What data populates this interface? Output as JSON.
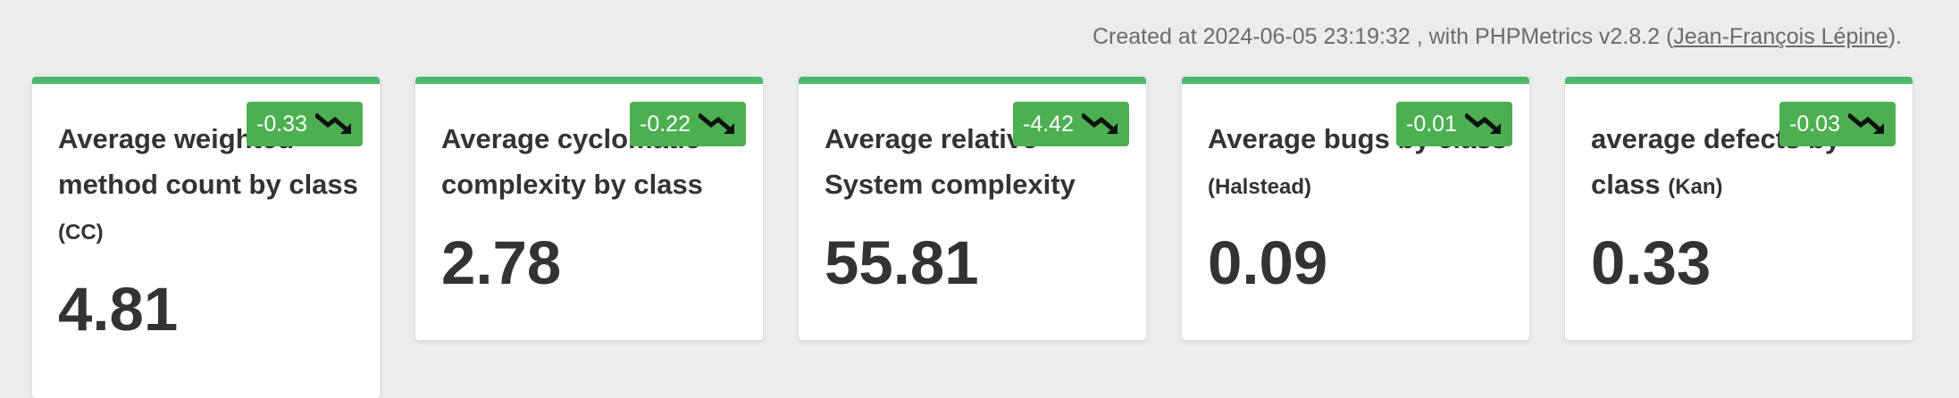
{
  "footer": {
    "created_prefix": "Created at 2024-06-05 23:19:32 , with PHPMetrics v2.8.2 (",
    "author_link": "Jean-François Lépine",
    "created_suffix": ")."
  },
  "colors": {
    "accent": "#4cb86a",
    "badge": "#4cb050",
    "background": "#ececec",
    "text": "#333333"
  },
  "cards": [
    {
      "title_main": "Average weighted method count by class",
      "title_sub": "(CC)",
      "value": "4.81",
      "delta": "-0.33",
      "trend_icon": "trending-down-icon"
    },
    {
      "title_main": "Average cyclomatic complexity by class",
      "title_sub": "",
      "value": "2.78",
      "delta": "-0.22",
      "trend_icon": "trending-down-icon"
    },
    {
      "title_main": "Average relative System complexity",
      "title_sub": "",
      "value": "55.81",
      "delta": "-4.42",
      "trend_icon": "trending-down-icon"
    },
    {
      "title_main": "Average bugs by class",
      "title_sub": "(Halstead)",
      "value": "0.09",
      "delta": "-0.01",
      "trend_icon": "trending-down-icon"
    },
    {
      "title_main": "average defects by class",
      "title_sub": "(Kan)",
      "value": "0.33",
      "delta": "-0.03",
      "trend_icon": "trending-down-icon"
    }
  ]
}
